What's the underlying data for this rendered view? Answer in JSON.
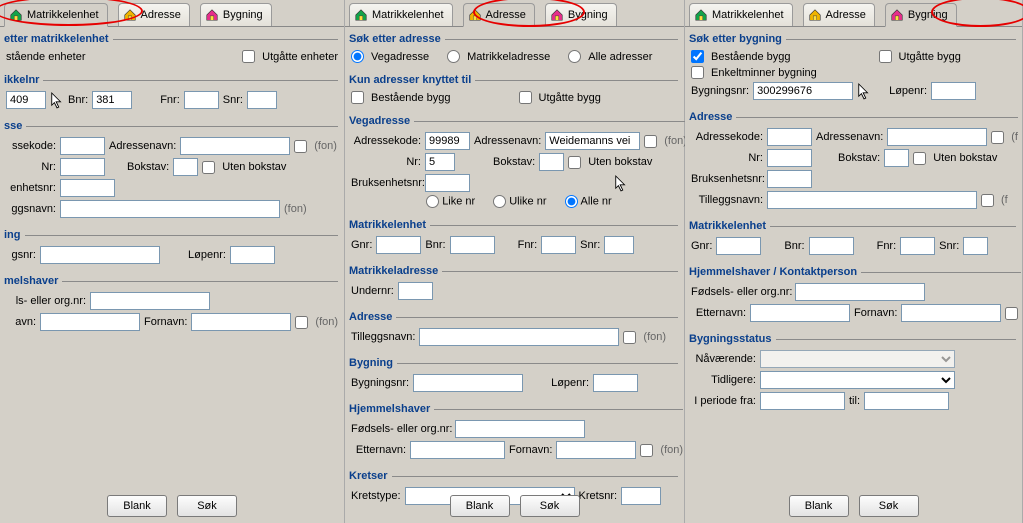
{
  "tabs": {
    "matrikkelenhet": "Matrikkelenhet",
    "adresse": "Adresse",
    "bygning": "Bygning"
  },
  "panel1": {
    "title": "etter matrikkelenhet",
    "bestaaende": "stående enheter",
    "utgaatte": "Utgåtte enheter",
    "matrikkelnr": "ikkelnr",
    "gnr": "409",
    "bnrLabel": "Bnr:",
    "bnr": "381",
    "fnrLabel": "Fnr:",
    "snrLabel": "Snr:",
    "adresseSection": "sse",
    "adressekodeLabel": "ssekode:",
    "adressenavnLabel": "Adressenavn:",
    "nrLabel": "Nr:",
    "bokstavLabel": "Bokstav:",
    "utenBokstav": "Uten bokstav",
    "bruksenhetsnrLabel": "enhetsnr:",
    "tilleggsnavnLabel": "ggsnavn:",
    "bygningSection": "ing",
    "bygningsnrLabel": "gsnr:",
    "lopenrLabel": "Løpenr:",
    "hjemmelshaverSection": "melshaver",
    "fodselsLabel": "ls- eller org.nr:",
    "etternavnLabel": "avn:",
    "fornavnLabel": "Fornavn:",
    "fon": "(fon)",
    "blank": "Blank",
    "sok": "Søk"
  },
  "panel2": {
    "title": "Søk etter adresse",
    "vegadresse": "Vegadresse",
    "matrikkeladresse": "Matrikkeladresse",
    "alleAdresser": "Alle adresser",
    "kunSection": "Kun adresser knyttet til",
    "bestaaendeBygg": "Bestående bygg",
    "utgaatteBygg": "Utgåtte bygg",
    "vegadresseSection": "Vegadresse",
    "adressekodeLabel": "Adressekode:",
    "adressekode": "99989",
    "adressenavnLabel": "Adressenavn:",
    "adressenavn": "Weidemanns vei",
    "nrLabel": "Nr:",
    "nr": "5",
    "bokstavLabel": "Bokstav:",
    "utenBokstav": "Uten bokstav",
    "bruksenhetsnrLabel": "Bruksenhetsnr:",
    "likeNr": "Like nr",
    "ulikeNr": "Ulike nr",
    "alleNr": "Alle nr",
    "matrikkelenhetSection": "Matrikkelenhet",
    "gnrLabel": "Gnr:",
    "bnrLabel": "Bnr:",
    "fnrLabel": "Fnr:",
    "snrLabel": "Snr:",
    "matrikkeladresseSection": "Matrikkeladresse",
    "undernrLabel": "Undernr:",
    "adresseSection": "Adresse",
    "tilleggsnavnLabel": "Tilleggsnavn:",
    "bygningSection": "Bygning",
    "bygningsnrLabel": "Bygningsnr:",
    "lopenrLabel": "Løpenr:",
    "hjemmelshaverSection": "Hjemmelshaver",
    "fodselsLabel": "Fødsels- eller org.nr:",
    "etternavnLabel": "Etternavn:",
    "fornavnLabel": "Fornavn:",
    "kretserSection": "Kretser",
    "kretstypeLabel": "Kretstype:",
    "kretsnrLabel": "Kretsnr:",
    "fon": "(fon)",
    "blank": "Blank",
    "sok": "Søk"
  },
  "panel3": {
    "title": "Søk etter bygning",
    "bestaaendeBygg": "Bestående bygg",
    "utgaatteBygg": "Utgåtte bygg",
    "enkeltminner": "Enkeltminner bygning",
    "bygningsnrLabel": "Bygningsnr:",
    "bygningsnr": "300299676",
    "lopenrLabel": "Løpenr:",
    "adresseSection": "Adresse",
    "adressekodeLabel": "Adressekode:",
    "adressenavnLabel": "Adressenavn:",
    "nrLabel": "Nr:",
    "bokstavLabel": "Bokstav:",
    "utenBokstav": "Uten bokstav",
    "bruksenhetsnrLabel": "Bruksenhetsnr:",
    "tilleggsnavnLabel": "Tilleggsnavn:",
    "matrikkelenhetSection": "Matrikkelenhet",
    "gnrLabel": "Gnr:",
    "bnrLabel": "Bnr:",
    "fnrLabel": "Fnr:",
    "snrLabel": "Snr:",
    "hjemmelshaverSection": "Hjemmelshaver / Kontaktperson",
    "fodselsLabel": "Fødsels- eller org.nr:",
    "etternavnLabel": "Etternavn:",
    "fornavnLabel": "Fornavn:",
    "bygningsstatusSection": "Bygningsstatus",
    "naavaerendeLabel": "Nåværende:",
    "tidligereLabel": "Tidligere:",
    "periodeFraLabel": "I periode fra:",
    "tilLabel": "til:",
    "fon": "(f",
    "blank": "Blank",
    "sok": "Søk"
  }
}
